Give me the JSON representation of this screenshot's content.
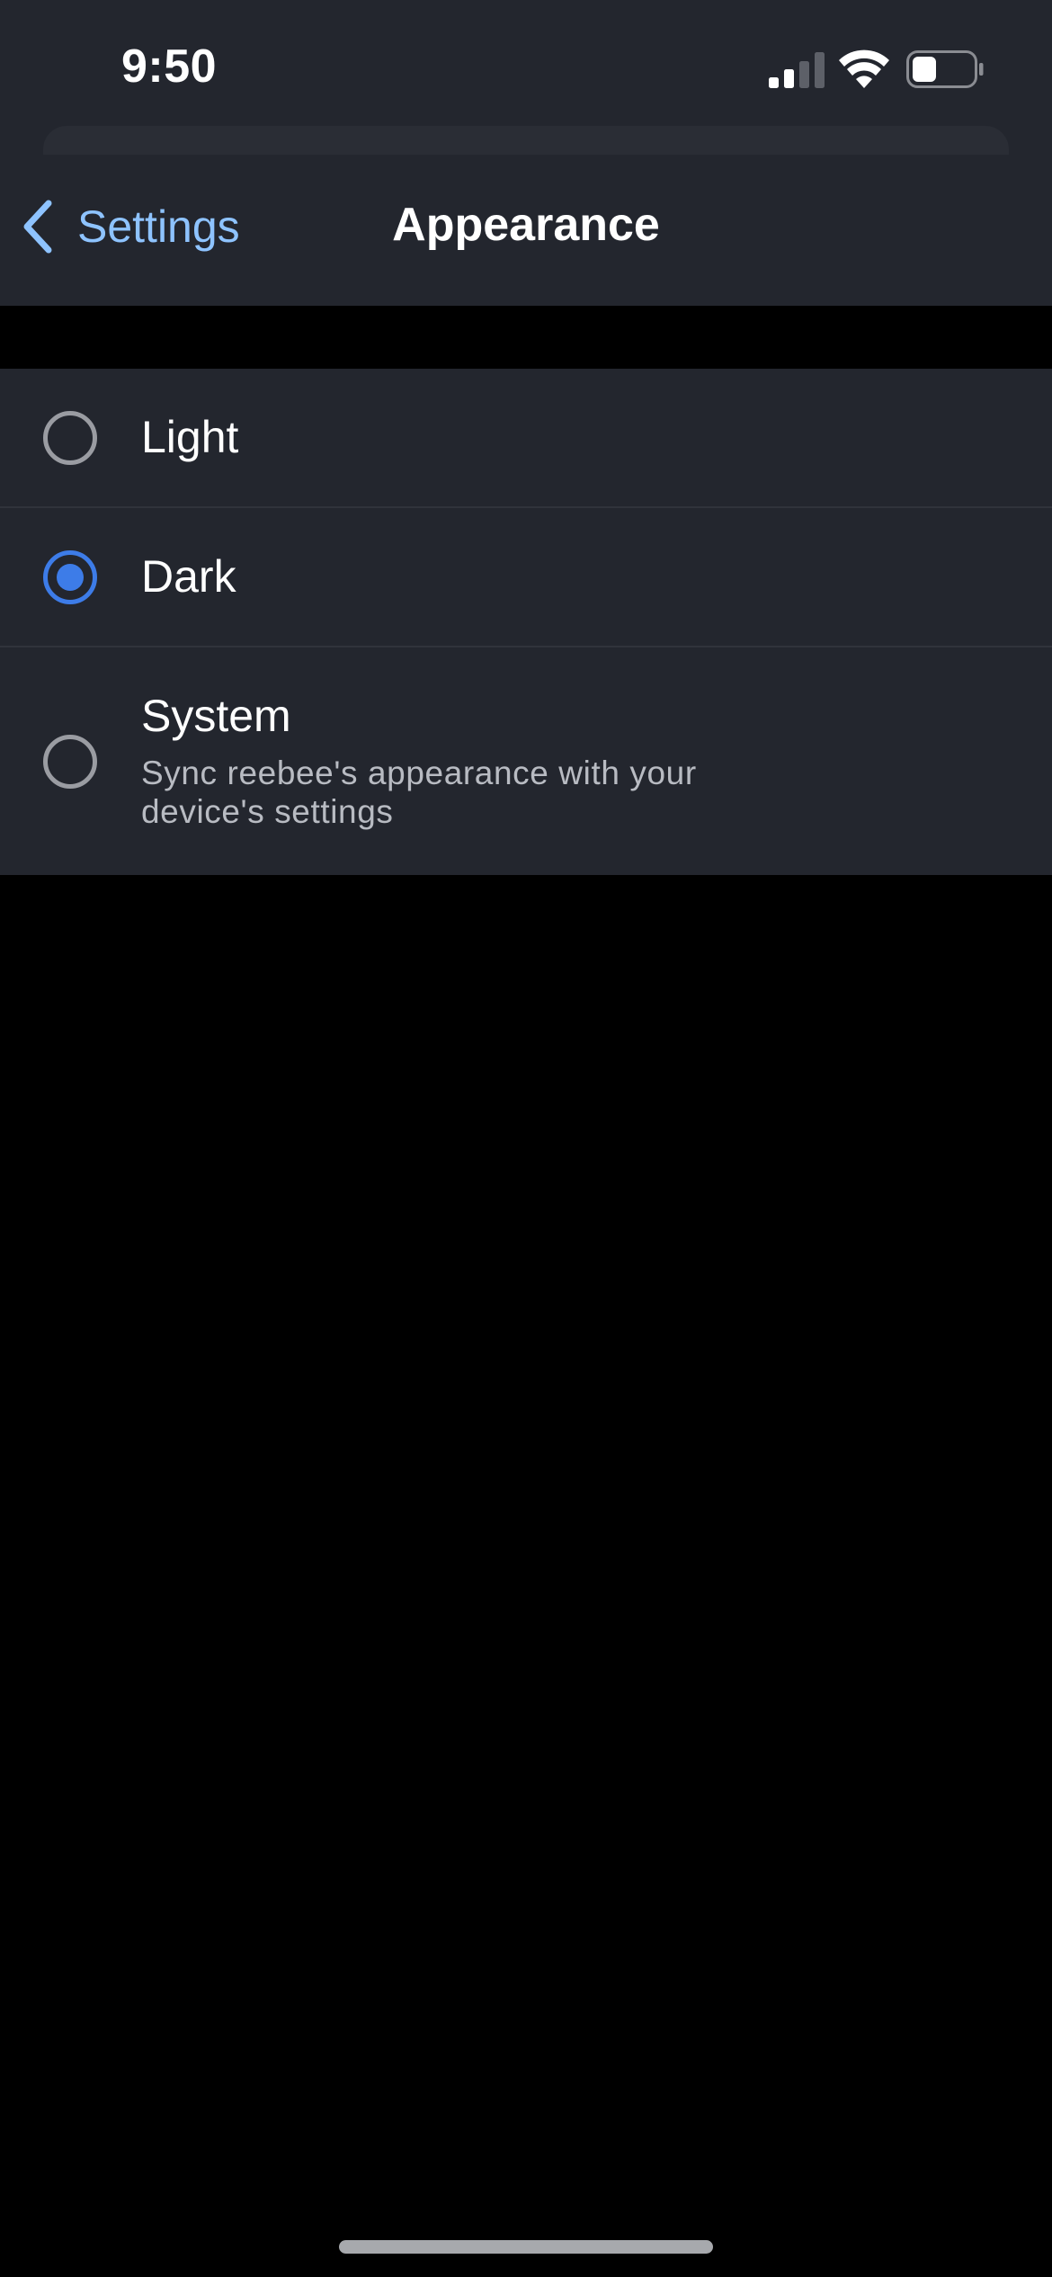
{
  "status_bar": {
    "time": "9:50",
    "signal_icon": "cellular-signal-icon",
    "wifi_icon": "wifi-icon",
    "battery_icon": "battery-icon",
    "battery_level": 0.4
  },
  "nav": {
    "back_label": "Settings",
    "back_icon": "chevron-left-icon",
    "title": "Appearance"
  },
  "options": [
    {
      "label": "Light",
      "description": "",
      "selected": false
    },
    {
      "label": "Dark",
      "description": "",
      "selected": true
    },
    {
      "label": "System",
      "description": "Sync reebee's appearance with your device's settings",
      "selected": false
    }
  ],
  "colors": {
    "accent": "#3d7ce8",
    "back_link": "#8ec3ff",
    "surface": "#23262e",
    "background": "#000000"
  }
}
